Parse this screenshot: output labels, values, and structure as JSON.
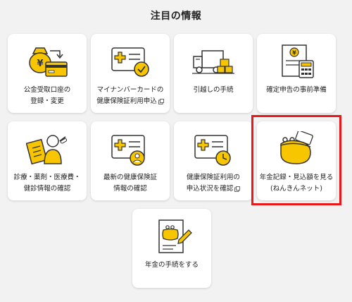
{
  "section_title": "注目の情報",
  "highlight_color": "#e8181b",
  "accent_color": "#f7c600",
  "cards": [
    {
      "label": "公金受取口座の\n登録・変更",
      "icon": "yen-bag-card-icon",
      "external": false
    },
    {
      "label": "マイナンバーカードの\n健康保険証利用申込",
      "icon": "card-check-icon",
      "external": true
    },
    {
      "label": "引越しの手続",
      "icon": "moving-truck-icon",
      "external": false
    },
    {
      "label": "確定申告の事前準備",
      "icon": "tax-document-calculator-icon",
      "external": false
    },
    {
      "label": "診療・薬剤・医療費・\n健診情報の確認",
      "icon": "medical-clipboard-person-icon",
      "external": false
    },
    {
      "label": "最新の健康保険証\n情報の確認",
      "icon": "card-person-icon",
      "external": false
    },
    {
      "label": "健康保険証利用の\n申込状況を確認",
      "icon": "card-clock-icon",
      "external": true
    },
    {
      "label": "年金記録・見込額を見る\n(ねんきんネット)",
      "icon": "coin-purse-icon",
      "external": false
    },
    {
      "label": "年金の手続をする",
      "icon": "purse-document-pencil-icon",
      "external": false
    }
  ]
}
